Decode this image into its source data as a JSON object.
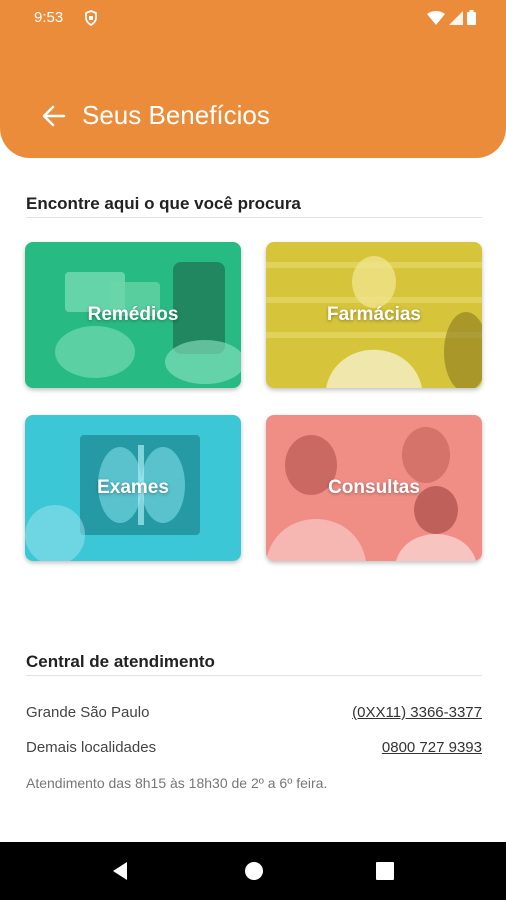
{
  "status_bar": {
    "time": "9:53"
  },
  "header": {
    "title": "Seus Benefícios"
  },
  "benefits": {
    "section_title": "Encontre aqui o que você procura",
    "cards": [
      {
        "label": "Remédios",
        "color": "#2BC48A"
      },
      {
        "label": "Farmácias",
        "color": "#D6C43A"
      },
      {
        "label": "Exames",
        "color": "#3CC7D6"
      },
      {
        "label": "Consultas",
        "color": "#F08E86"
      }
    ]
  },
  "support": {
    "section_title": "Central de atendimento",
    "rows": [
      {
        "label": "Grande São Paulo",
        "phone": "(0XX11) 3366-3377"
      },
      {
        "label": "Demais localidades",
        "phone": "0800 727 9393"
      }
    ],
    "hours_note": "Atendimento das 8h15 às 18h30 de 2º a 6º feira."
  }
}
